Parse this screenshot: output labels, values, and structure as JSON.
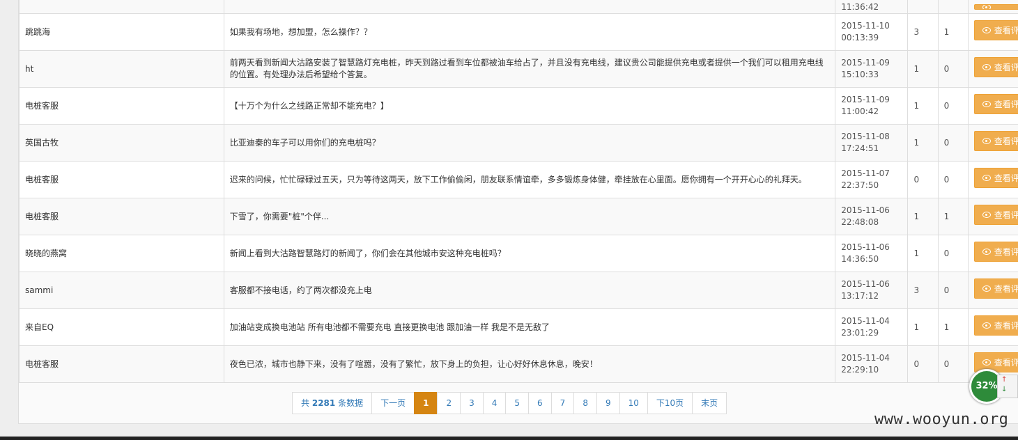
{
  "rows": [
    {
      "user": "",
      "text": "",
      "date": "",
      "time": "11:36:42",
      "n1": "",
      "n2": "",
      "action": "查看评论"
    },
    {
      "user": "跳跳海",
      "text": "如果我有场地，想加盟，怎么操作？？",
      "date": "2015-11-10",
      "time": "00:13:39",
      "n1": "3",
      "n2": "1",
      "action": "查看评论"
    },
    {
      "user": "ht",
      "text": "前两天看到新闻大沽路安装了智慧路灯充电桩，昨天到路过看到车位都被油车给占了，并且没有充电线，建议贵公司能提供充电或者提供一个我们可以租用充电线的位置。有处理办法后希望给个答复。",
      "date": "2015-11-09",
      "time": "15:10:33",
      "n1": "1",
      "n2": "0",
      "action": "查看评论"
    },
    {
      "user": "电桩客服",
      "text": "【十万个为什么之线路正常却不能充电？】",
      "date": "2015-11-09",
      "time": "11:00:42",
      "n1": "1",
      "n2": "0",
      "action": "查看评论"
    },
    {
      "user": "英国古牧",
      "text": "比亚迪秦的车子可以用你们的充电桩吗？",
      "date": "2015-11-08",
      "time": "17:24:51",
      "n1": "1",
      "n2": "0",
      "action": "查看评论"
    },
    {
      "user": "电桩客服",
      "text": "迟来的问候，忙忙碌碌过五天，只为等待这两天，放下工作偷偷闲，朋友联系情谊牵，多多锻炼身体健，牵挂放在心里面。愿你拥有一个开开心心的礼拜天。",
      "date": "2015-11-07",
      "time": "22:37:50",
      "n1": "0",
      "n2": "0",
      "action": "查看评论"
    },
    {
      "user": "电桩客服",
      "text": "下雪了，你需要\"桩\"个伴...",
      "date": "2015-11-06",
      "time": "22:48:08",
      "n1": "1",
      "n2": "1",
      "action": "查看评论"
    },
    {
      "user": "晓晓的燕窝",
      "text": "新闻上看到大沽路智慧路灯的新闻了，你们会在其他城市安这种充电桩吗？",
      "date": "2015-11-06",
      "time": "14:36:50",
      "n1": "1",
      "n2": "0",
      "action": "查看评论"
    },
    {
      "user": "sammi",
      "text": "客服都不接电话，约了两次都没充上电",
      "date": "2015-11-06",
      "time": "13:17:12",
      "n1": "3",
      "n2": "0",
      "action": "查看评论"
    },
    {
      "user": "来自EQ",
      "text": "加油站变成换电池站 所有电池都不需要充电 直接更换电池 跟加油一样 我是不是无敌了",
      "date": "2015-11-04",
      "time": "23:01:29",
      "n1": "1",
      "n2": "1",
      "action": "查看评论"
    },
    {
      "user": "电桩客服",
      "text": "夜色已浓，城市也静下来，没有了喧嚣，没有了繁忙，放下身上的负担，让心好好休息休息，晚安！",
      "date": "2015-11-04",
      "time": "22:29:10",
      "n1": "0",
      "n2": "0",
      "action": "查看评论"
    }
  ],
  "pagination": {
    "total_prefix": "共",
    "total_count": "2281",
    "total_suffix": "条数据",
    "next": "下一页",
    "pages": [
      "1",
      "2",
      "3",
      "4",
      "5",
      "6",
      "7",
      "8",
      "9",
      "10"
    ],
    "active": "1",
    "next10": "下10页",
    "last": "末页"
  },
  "watermark": "www.wooyun.org",
  "speed_widget": {
    "percent": "32%",
    "up": "↑",
    "down": "↓"
  },
  "colors": {
    "action": "#f0ad4e",
    "active_page": "#d58512",
    "link": "#337ab7"
  }
}
